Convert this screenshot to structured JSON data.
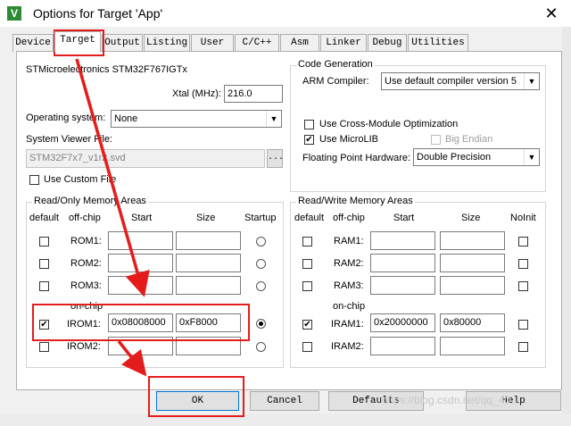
{
  "window": {
    "title": "Options for Target 'App'",
    "icon": "app-icon",
    "close_glyph": "✕"
  },
  "tabs": [
    "Device",
    "Target",
    "Output",
    "Listing",
    "User",
    "C/C++",
    "Asm",
    "Linker",
    "Debug",
    "Utilities"
  ],
  "target": {
    "device": "STMicroelectronics STM32F767IGTx",
    "xtal_label": "Xtal (MHz):",
    "xtal_value": "216.0",
    "os_label": "Operating system:",
    "os_value": "None",
    "svd_label": "System Viewer File:",
    "svd_value": "STM32F7x7_v1r2.svd",
    "svd_browse": "...",
    "custom_file_label": "Use Custom File"
  },
  "codegen": {
    "title": "Code Generation",
    "compiler_label": "ARM Compiler:",
    "compiler_value": "Use default compiler version 5",
    "cross_module_label": "Use Cross-Module Optimization",
    "microlib_label": "Use MicroLIB",
    "big_endian_label": "Big Endian",
    "fpu_label": "Floating Point Hardware:",
    "fpu_value": "Double Precision",
    "check": "✔"
  },
  "rom": {
    "title": "Read/Only Memory Areas",
    "headers": {
      "default": "default",
      "offchip": "off-chip",
      "start": "Start",
      "size": "Size",
      "startup": "Startup"
    },
    "onchip_label": "on-chip",
    "offchip_rows": [
      {
        "label": "ROM1:",
        "start": "",
        "size": ""
      },
      {
        "label": "ROM2:",
        "start": "",
        "size": ""
      },
      {
        "label": "ROM3:",
        "start": "",
        "size": ""
      }
    ],
    "onchip_rows": [
      {
        "label": "IROM1:",
        "start": "0x08008000",
        "size": "0xF8000",
        "checked": true,
        "startup": true
      },
      {
        "label": "IROM2:",
        "start": "",
        "size": "",
        "checked": false,
        "startup": false
      }
    ]
  },
  "ram": {
    "title": "Read/Write Memory Areas",
    "headers": {
      "default": "default",
      "offchip": "off-chip",
      "start": "Start",
      "size": "Size",
      "noinit": "NoInit"
    },
    "onchip_label": "on-chip",
    "offchip_rows": [
      {
        "label": "RAM1:",
        "start": "",
        "size": ""
      },
      {
        "label": "RAM2:",
        "start": "",
        "size": ""
      },
      {
        "label": "RAM3:",
        "start": "",
        "size": ""
      }
    ],
    "onchip_rows": [
      {
        "label": "IRAM1:",
        "start": "0x20000000",
        "size": "0x80000",
        "checked": true
      },
      {
        "label": "IRAM2:",
        "start": "",
        "size": "",
        "checked": false
      }
    ]
  },
  "buttons": {
    "ok": "OK",
    "cancel": "Cancel",
    "defaults": "Defaults",
    "help": "Help"
  },
  "watermark": "https://blog.csdn.net/qq_40...",
  "colors": {
    "annotation": "#e51c1c",
    "default_button_border": "#0078d7"
  }
}
